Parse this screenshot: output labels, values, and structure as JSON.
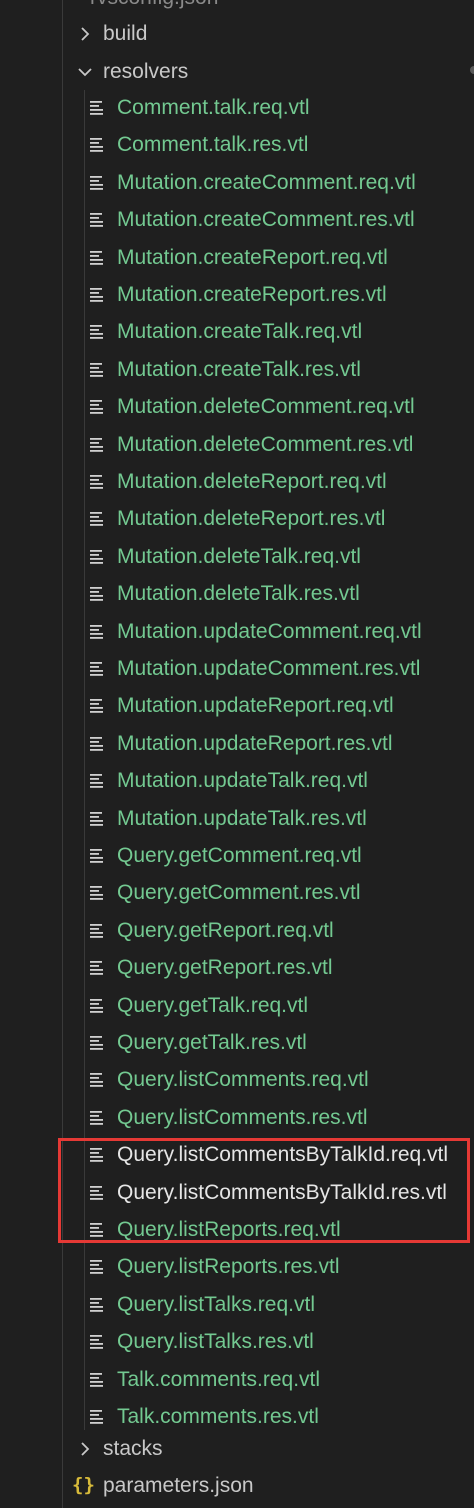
{
  "explorer": {
    "clipped_top_label": "rvsconfig.json",
    "folders": {
      "build": "build",
      "resolvers": "resolvers",
      "stacks": "stacks"
    },
    "resolver_files": [
      "Comment.talk.req.vtl",
      "Comment.talk.res.vtl",
      "Mutation.createComment.req.vtl",
      "Mutation.createComment.res.vtl",
      "Mutation.createReport.req.vtl",
      "Mutation.createReport.res.vtl",
      "Mutation.createTalk.req.vtl",
      "Mutation.createTalk.res.vtl",
      "Mutation.deleteComment.req.vtl",
      "Mutation.deleteComment.res.vtl",
      "Mutation.deleteReport.req.vtl",
      "Mutation.deleteReport.res.vtl",
      "Mutation.deleteTalk.req.vtl",
      "Mutation.deleteTalk.res.vtl",
      "Mutation.updateComment.req.vtl",
      "Mutation.updateComment.res.vtl",
      "Mutation.updateReport.req.vtl",
      "Mutation.updateReport.res.vtl",
      "Mutation.updateTalk.req.vtl",
      "Mutation.updateTalk.res.vtl",
      "Query.getComment.req.vtl",
      "Query.getComment.res.vtl",
      "Query.getReport.req.vtl",
      "Query.getReport.res.vtl",
      "Query.getTalk.req.vtl",
      "Query.getTalk.res.vtl",
      "Query.listComments.req.vtl",
      "Query.listComments.res.vtl",
      "Query.listCommentsByTalkId.req.vtl",
      "Query.listCommentsByTalkId.res.vtl",
      "Query.listReports.req.vtl",
      "Query.listReports.res.vtl",
      "Query.listTalks.req.vtl",
      "Query.listTalks.res.vtl",
      "Talk.comments.req.vtl",
      "Talk.comments.res.vtl"
    ],
    "highlighted_indices": [
      28,
      29
    ],
    "json_file": "parameters.json",
    "json_icon_glyph": "{}"
  },
  "colors": {
    "background": "#1f1f1f",
    "file_untracked": "#73c991",
    "folder_text": "#c8c8c8",
    "highlight_border": "#e53935",
    "json_icon": "#d7ba3a"
  }
}
